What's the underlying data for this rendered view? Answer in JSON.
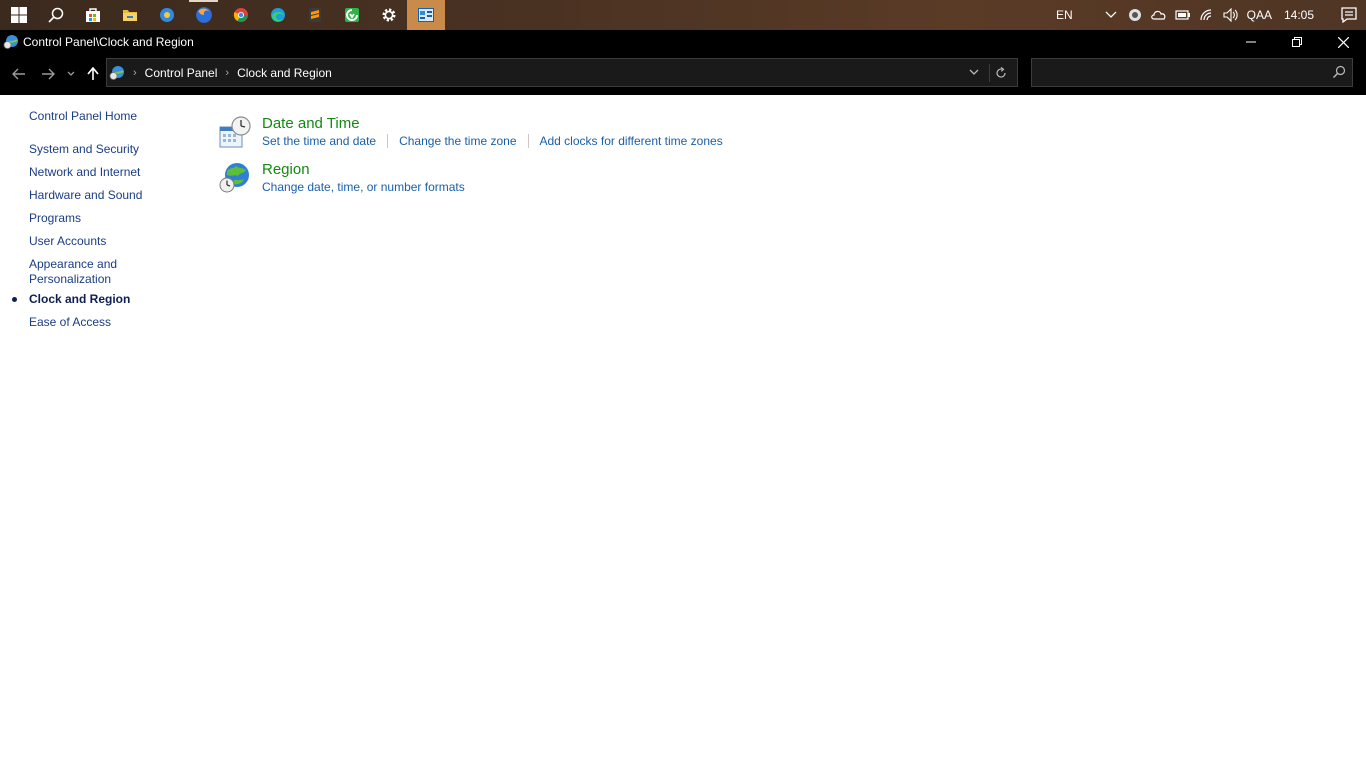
{
  "taskbar": {
    "apps": [
      "start-icon",
      "search-icon",
      "store-icon",
      "file-explorer-icon",
      "browser-icon",
      "firefox-icon",
      "chrome-icon",
      "edge-icon",
      "sublime-text-icon",
      "green-app-icon",
      "settings-icon",
      "control-panel-icon"
    ],
    "language": "EN",
    "user": "QAA",
    "time": "14:05"
  },
  "window": {
    "title": "Control Panel\\Clock and Region"
  },
  "address": {
    "crumbs": [
      "Control Panel",
      "Clock and Region"
    ],
    "search_placeholder": ""
  },
  "sidebar": {
    "home": "Control Panel Home",
    "items": [
      {
        "label": "System and Security"
      },
      {
        "label": "Network and Internet"
      },
      {
        "label": "Hardware and Sound"
      },
      {
        "label": "Programs"
      },
      {
        "label": "User Accounts"
      },
      {
        "label": "Appearance and Personalization"
      },
      {
        "label": "Clock and Region",
        "current": true
      },
      {
        "label": "Ease of Access"
      }
    ]
  },
  "categories": [
    {
      "title": "Date and Time",
      "icon": "date-time-icon",
      "links": [
        "Set the time and date",
        "Change the time zone",
        "Add clocks for different time zones"
      ]
    },
    {
      "title": "Region",
      "icon": "region-globe-icon",
      "links": [
        "Change date, time, or number formats"
      ]
    }
  ],
  "colors": {
    "category_title": "#138a13",
    "link": "#1a5faa",
    "sidebar_link": "#1a3d84",
    "taskbar_active": "#c98b4a"
  }
}
